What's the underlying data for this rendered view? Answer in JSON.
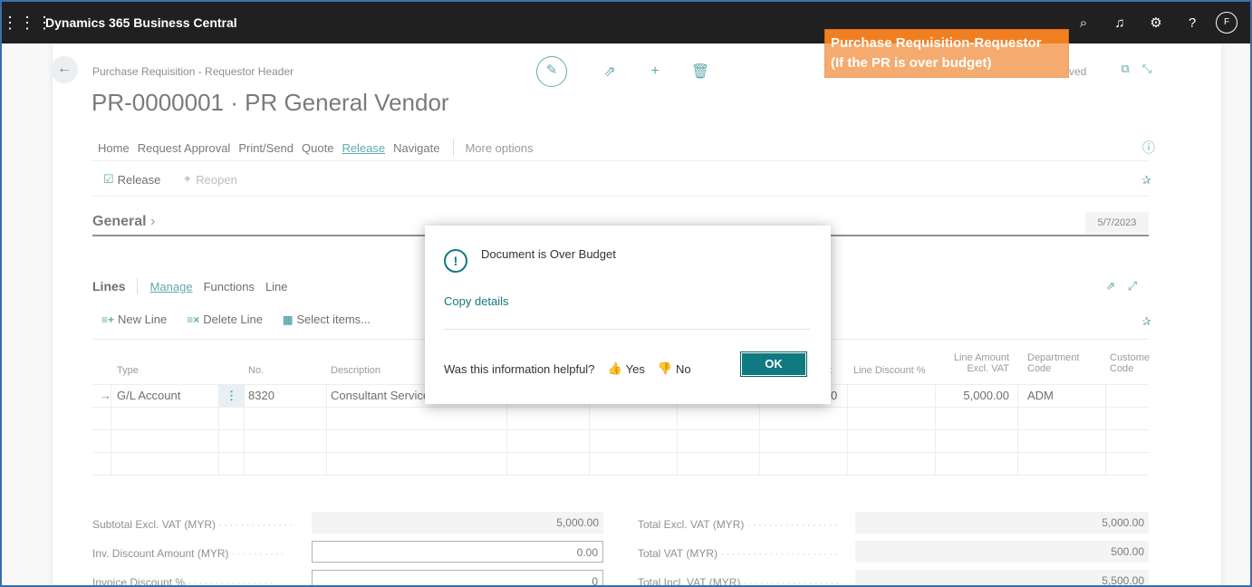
{
  "app": {
    "title": "Dynamics 365 Business Central",
    "avatar": "F"
  },
  "annotation": {
    "line1": "Purchase Requisition-Requestor",
    "line2": "(If the PR is over budget)"
  },
  "header": {
    "breadcrumb": "Purchase Requisition - Requestor Header",
    "title": "PR-0000001 · PR General Vendor",
    "saved_status": "ved"
  },
  "menu": {
    "items": [
      "Home",
      "Request Approval",
      "Print/Send",
      "Quote",
      "Release",
      "Navigate"
    ],
    "more": "More options"
  },
  "actions": {
    "release": "Release",
    "reopen": "Reopen"
  },
  "general": {
    "label": "General",
    "date": "5/7/2023"
  },
  "lines": {
    "label": "Lines",
    "tabs": [
      "Manage",
      "Functions",
      "Line"
    ],
    "actions": {
      "new_line": "New Line",
      "delete_line": "Delete Line",
      "select_items": "Select items..."
    },
    "headers": {
      "type": "Type",
      "no": "No.",
      "description": "Description",
      "partial": "t",
      "line_discount": "Line Discount %",
      "line_amount_1": "Line Amount",
      "line_amount_2": "Excl. VAT",
      "department_1": "Department",
      "department_2": "Code",
      "customer_1": "Custome",
      "customer_2": "Code"
    },
    "row": {
      "arrow": "→",
      "type": "G/L Account",
      "no": "8320",
      "description": "Consultant Service",
      "partial": "0",
      "line_amount": "5,000.00",
      "department": "ADM"
    }
  },
  "totals": {
    "subtotal_label": "Subtotal Excl. VAT (MYR)",
    "subtotal_value": "5,000.00",
    "inv_discount_label": "Inv. Discount Amount (MYR)",
    "inv_discount_value": "0.00",
    "invoice_discount_pct_label": "Invoice Discount %",
    "invoice_discount_pct_value": "0",
    "total_excl_label": "Total Excl. VAT (MYR)",
    "total_excl_value": "5,000.00",
    "total_vat_label": "Total VAT (MYR)",
    "total_vat_value": "500.00",
    "total_incl_label": "Total Incl. VAT (MYR)",
    "total_incl_value": "5,500.00"
  },
  "dialog": {
    "message": "Document is Over Budget",
    "copy_details": "Copy details",
    "helpful_question": "Was this information helpful?",
    "yes": "Yes",
    "no": "No",
    "ok": "OK"
  }
}
